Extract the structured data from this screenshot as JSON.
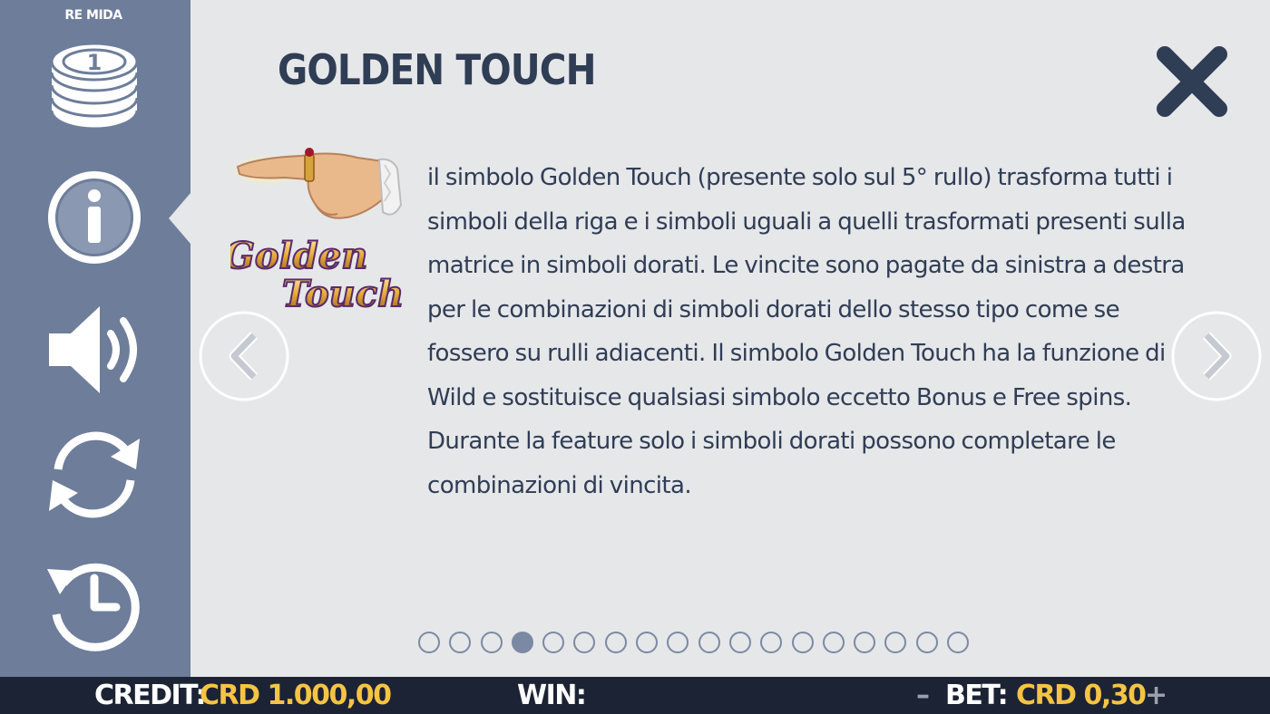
{
  "app": {
    "title": "RE MIDA"
  },
  "sidebar": {
    "items": [
      {
        "id": "coins",
        "icon": "coin-stack-icon",
        "badge": "1"
      },
      {
        "id": "info",
        "icon": "info-icon",
        "active": true
      },
      {
        "id": "sound",
        "icon": "speaker-icon"
      },
      {
        "id": "autoplay",
        "icon": "refresh-icon"
      },
      {
        "id": "history",
        "icon": "history-clock-icon"
      }
    ]
  },
  "page": {
    "title": "GOLDEN TOUCH",
    "symbol_logo": [
      "Golden",
      "Touch"
    ],
    "description": "il simbolo Golden Touch (presente solo sul 5° rullo) trasforma tutti i simboli della riga e i simboli uguali a quelli trasformati presenti sulla matrice in simboli dorati. Le vincite sono pagate da sinistra a destra per le combinazioni di simboli dorati dello stesso tipo come se fossero su rulli adiacenti. Il simbolo Golden Touch ha la funzione di Wild e sostituisce qualsiasi simbolo eccetto Bonus e Free spins. Durante la feature solo i simboli dorati possono completare le combinazioni di vincita."
  },
  "pagination": {
    "total": 18,
    "current": 4
  },
  "statusbar": {
    "credit_label": "CREDIT:",
    "credit_value": "CRD 1.000,00",
    "win_label": "WIN:",
    "bet_minus": "–",
    "bet_label": "BET:",
    "bet_value": "CRD 0,30",
    "bet_plus": "+"
  },
  "colors": {
    "sidebar": "#6d7d9a",
    "panel": "#e6e7e9",
    "title": "#2f3d55",
    "statusbar": "#1c2334",
    "value": "#f6c443"
  }
}
